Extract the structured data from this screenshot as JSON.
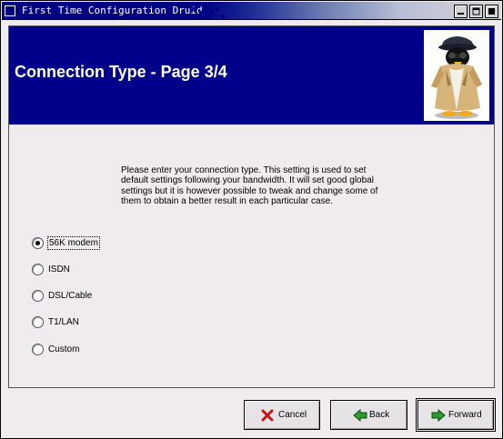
{
  "window": {
    "title": "First Time Configuration Druid"
  },
  "header": {
    "title": "Connection Type - Page 3/4"
  },
  "description": "Please enter your connection type. This setting is used to set default settings following your bandwidth. It will set good global settings but it is however possible to tweak and change some of them to obtain a better result in each particular case.",
  "options": [
    {
      "label": "56K modem",
      "selected": true
    },
    {
      "label": "ISDN",
      "selected": false
    },
    {
      "label": "DSL/Cable",
      "selected": false
    },
    {
      "label": "T1/LAN",
      "selected": false
    },
    {
      "label": "Custom",
      "selected": false
    }
  ],
  "buttons": {
    "cancel": "Cancel",
    "back": "Back",
    "forward": "Forward"
  },
  "colors": {
    "banner": "#00008b",
    "titlebar": "#000080",
    "background": "#efebef"
  }
}
